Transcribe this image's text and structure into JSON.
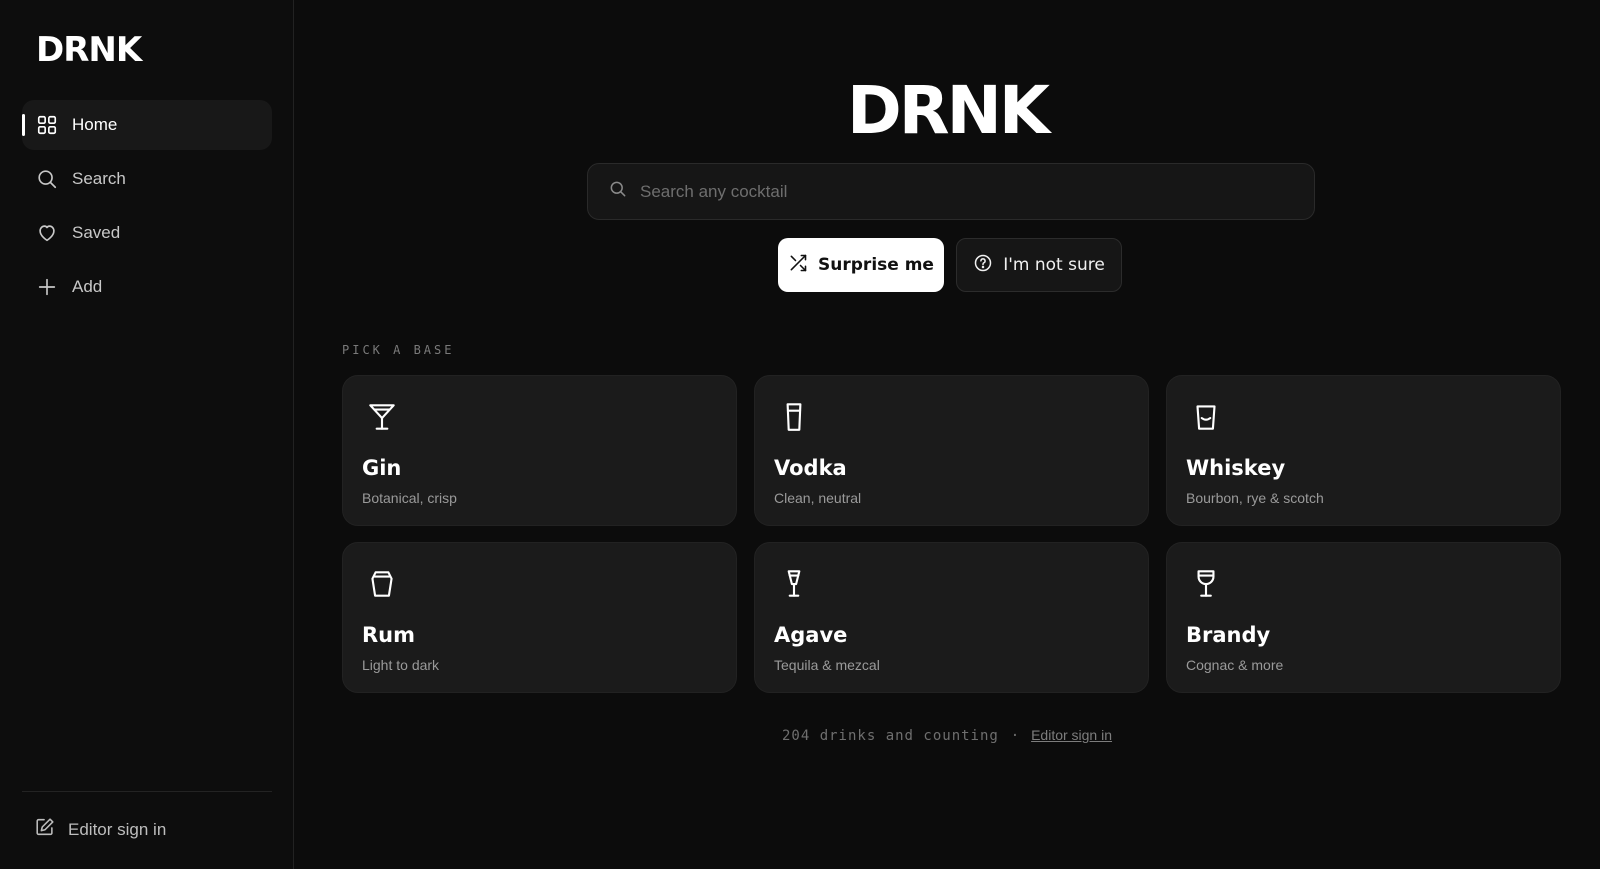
{
  "sidebar": {
    "brand": "DRNK",
    "items": [
      {
        "label": "Home",
        "icon": "grid-icon",
        "active": true
      },
      {
        "label": "Search",
        "icon": "search-icon"
      },
      {
        "label": "Saved",
        "icon": "heart-icon"
      },
      {
        "label": "Add",
        "icon": "plus-icon"
      }
    ],
    "editor_label": "Editor sign in"
  },
  "main": {
    "title": "DRNK",
    "search": {
      "placeholder": "Search any cocktail",
      "value": ""
    },
    "buttons": {
      "surprise": "Surprise me",
      "not_sure": "I'm not sure"
    },
    "section_label": "PICK A BASE",
    "bases": [
      {
        "name": "Gin",
        "desc": "Botanical, crisp",
        "icon": "martini-glass-icon"
      },
      {
        "name": "Vodka",
        "desc": "Clean, neutral",
        "icon": "highball-glass-icon"
      },
      {
        "name": "Whiskey",
        "desc": "Bourbon, rye & scotch",
        "icon": "rocks-glass-icon"
      },
      {
        "name": "Rum",
        "desc": "Light to dark",
        "icon": "tumbler-glass-icon"
      },
      {
        "name": "Agave",
        "desc": "Tequila & mezcal",
        "icon": "cocktail-glass-icon"
      },
      {
        "name": "Brandy",
        "desc": "Cognac & more",
        "icon": "snifter-glass-icon"
      }
    ],
    "footer": {
      "count_text": "204 drinks and counting",
      "separator": "·",
      "link": "Editor sign in"
    }
  },
  "colors": {
    "background": "#0c0c0c",
    "card": "#1b1b1b",
    "primary_button": "#ffffff"
  }
}
